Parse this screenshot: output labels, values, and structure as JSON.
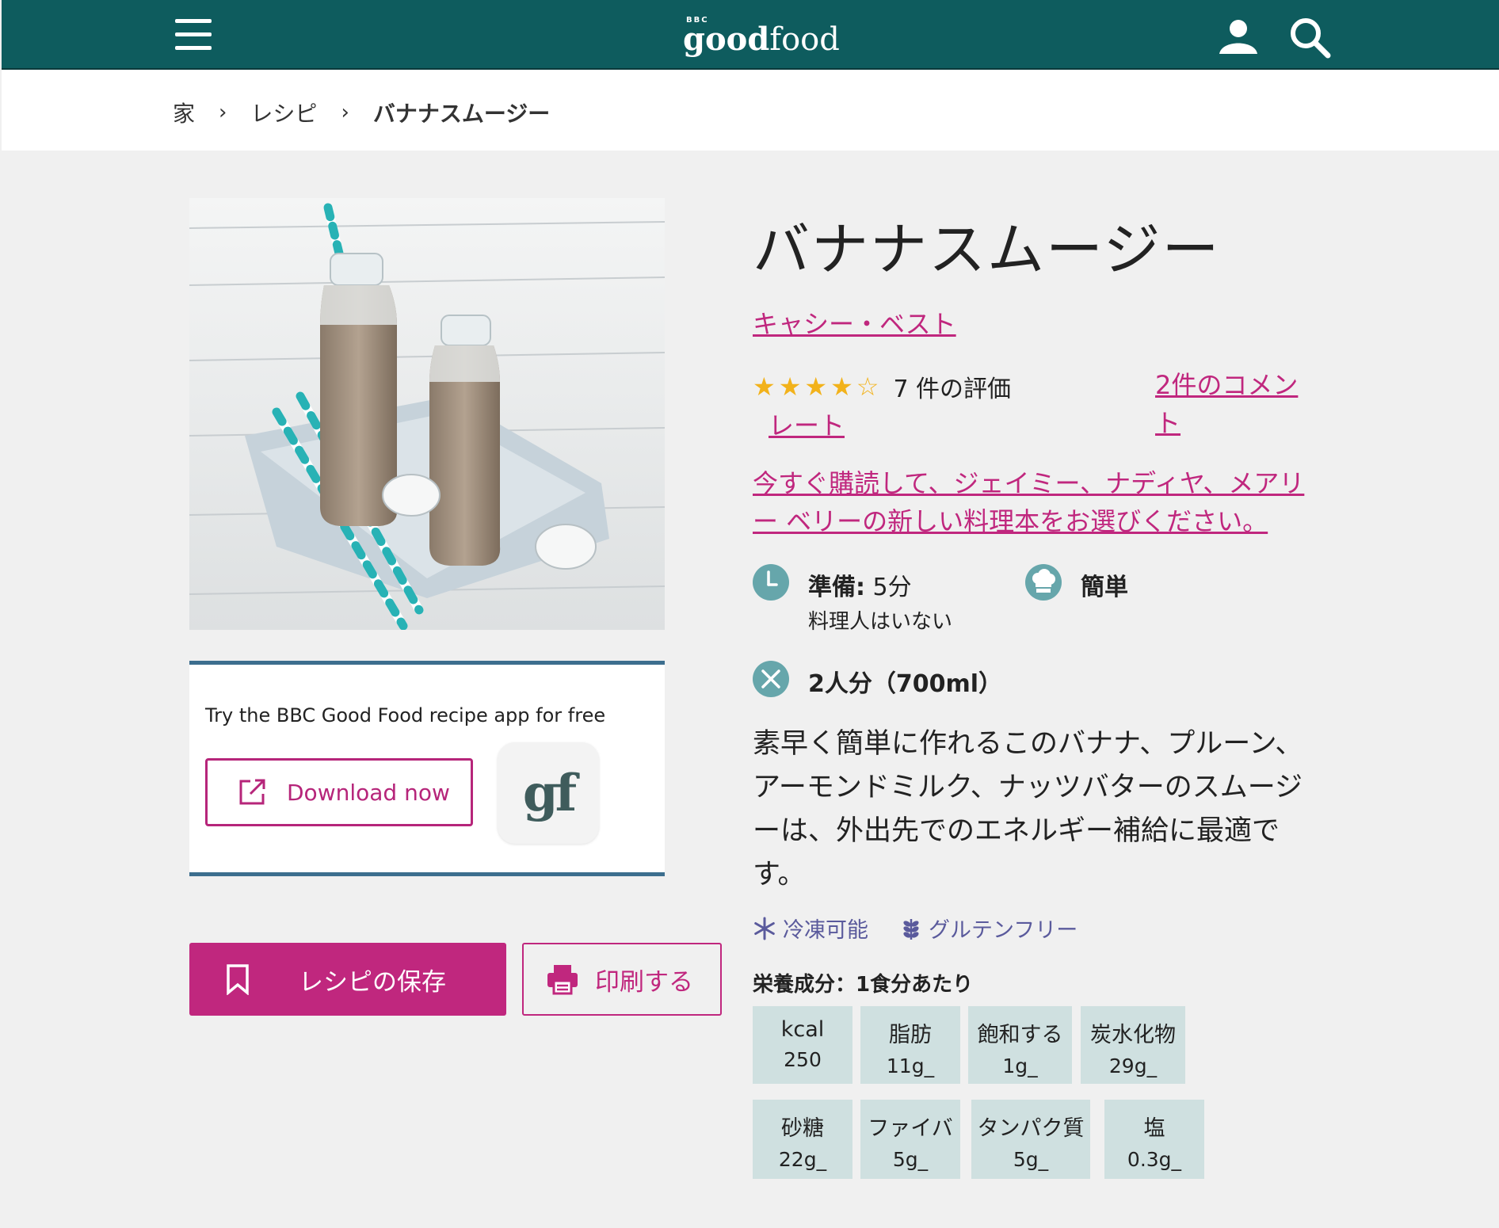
{
  "header": {
    "logo_bbc": "BBC",
    "logo_good": "good",
    "logo_food": "food"
  },
  "breadcrumb": {
    "home": "家",
    "recipes": "レシピ",
    "current": "バナナスムージー"
  },
  "promo": {
    "text": "Try the BBC Good Food recipe app for free",
    "download_label": "Download now",
    "app_icon_text": "gf"
  },
  "actions": {
    "save_label": "レシピの保存",
    "print_label": "印刷する"
  },
  "recipe": {
    "title": "バナナスムージー",
    "author": "キャシー・ベスト",
    "rating_stars": "★★★★☆",
    "rating_value": 4,
    "rating_count": "7 件の評価",
    "rate_link": "レート",
    "comments_link": "2件のコメント",
    "subscribe_text": "今すぐ購読して、ジェイミー、ナディヤ、メアリー ベリーの新しい料理本をお選びください。",
    "prep_label": "準備:",
    "prep_value": "5分",
    "cook_text": "料理人はいない",
    "difficulty": "簡単",
    "serves": "2人分（700ml）",
    "description": "素早く簡単に作れるこのバナナ、プルーン、アーモンドミルク、ナッツバターのスムージーは、外出先でのエネルギー補給に最適です。",
    "tags": [
      "冷凍可能",
      "グルテンフリー"
    ]
  },
  "nutrition": {
    "title": "栄養成分：1食分あたり",
    "row1": [
      {
        "label": "kcal",
        "value": "250"
      },
      {
        "label": "脂肪",
        "value": "11g_"
      },
      {
        "label": "飽和する",
        "value": "1g_"
      },
      {
        "label": "炭水化物",
        "value": "29g_"
      }
    ],
    "row2": [
      {
        "label": "砂糖",
        "value": "22g_"
      },
      {
        "label": "ファイバ",
        "value": "5g_"
      },
      {
        "label": "タンパク質",
        "value": "5g_"
      },
      {
        "label": "塩",
        "value": "0.3g_"
      }
    ]
  },
  "colors": {
    "header_bg": "#0e5c5e",
    "accent": "#c0277e",
    "icon_circle": "#66a6ab",
    "nutrition_cell": "#cfe0e0",
    "star": "#f2b21b",
    "tag_text": "#5a5a9c"
  }
}
